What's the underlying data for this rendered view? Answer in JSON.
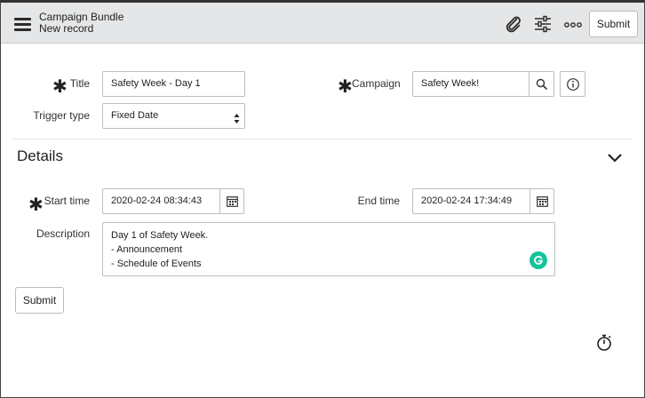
{
  "header": {
    "title": "Campaign Bundle",
    "subtitle": "New record",
    "submit_label": "Submit",
    "icons": [
      "menu-icon",
      "paperclip-icon",
      "settings-sliders-icon",
      "more-options-icon"
    ]
  },
  "form": {
    "title_label": "Title",
    "title_value": "Safety Week - Day 1",
    "campaign_label": "Campaign",
    "campaign_value": "Safety Week!",
    "trigger_label": "Trigger type",
    "trigger_value": "Fixed Date"
  },
  "details": {
    "heading": "Details",
    "start_label": "Start time",
    "start_value": "2020-02-24 08:34:43",
    "end_label": "End time",
    "end_value": "2020-02-24 17:34:49",
    "description_label": "Description",
    "description_value": "Day 1 of Safety Week.\n- Announcement\n- Schedule of Events"
  },
  "footer": {
    "submit_label": "Submit"
  },
  "colors": {
    "header_bg": "#e4e6e7",
    "grammarly": "#15c39a"
  }
}
